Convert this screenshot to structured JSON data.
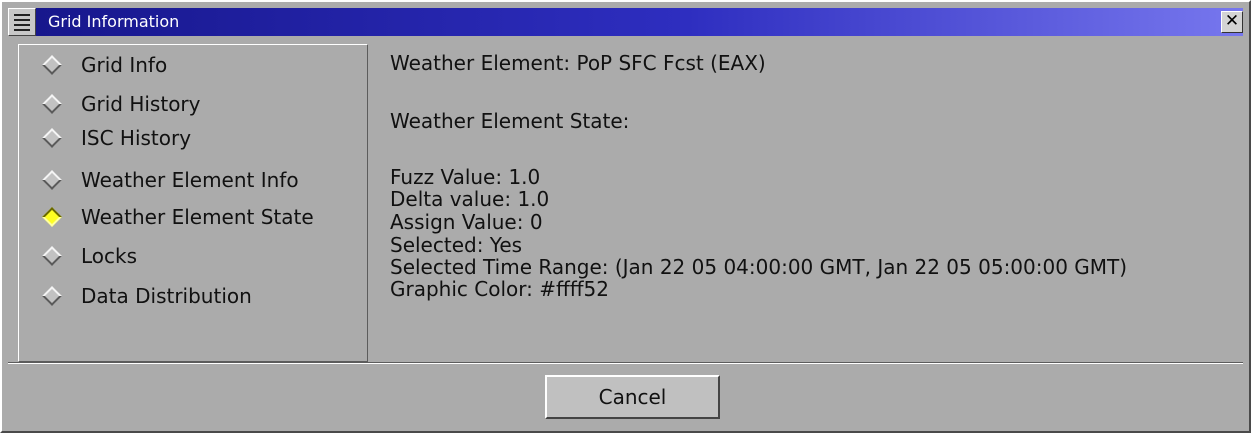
{
  "window": {
    "title": "Grid Information",
    "close_glyph": "✕"
  },
  "sidebar": {
    "items": [
      {
        "label": "Grid Info",
        "selected": false
      },
      {
        "label": "Grid History",
        "selected": false
      },
      {
        "label": "ISC History",
        "selected": false
      },
      {
        "label": "Weather Element Info",
        "selected": false
      },
      {
        "label": "Weather Element State",
        "selected": true
      },
      {
        "label": "Locks",
        "selected": false
      },
      {
        "label": "Data Distribution",
        "selected": false
      }
    ]
  },
  "content": {
    "lines": [
      "Weather Element: PoP SFC Fcst (EAX)",
      "Weather Element State:",
      "Fuzz Value: 1.0",
      "Delta value: 1.0",
      "Assign Value: 0",
      "Selected: Yes",
      "Selected Time Range: (Jan 22 05 04:00:00 GMT, Jan 22 05 05:00:00 GMT)",
      "Graphic Color: #ffff52"
    ]
  },
  "buttons": {
    "cancel": "Cancel"
  },
  "colors": {
    "title_bar": "#1e1e9e",
    "selected_radio": "#ffff22",
    "background": "#ababab"
  }
}
